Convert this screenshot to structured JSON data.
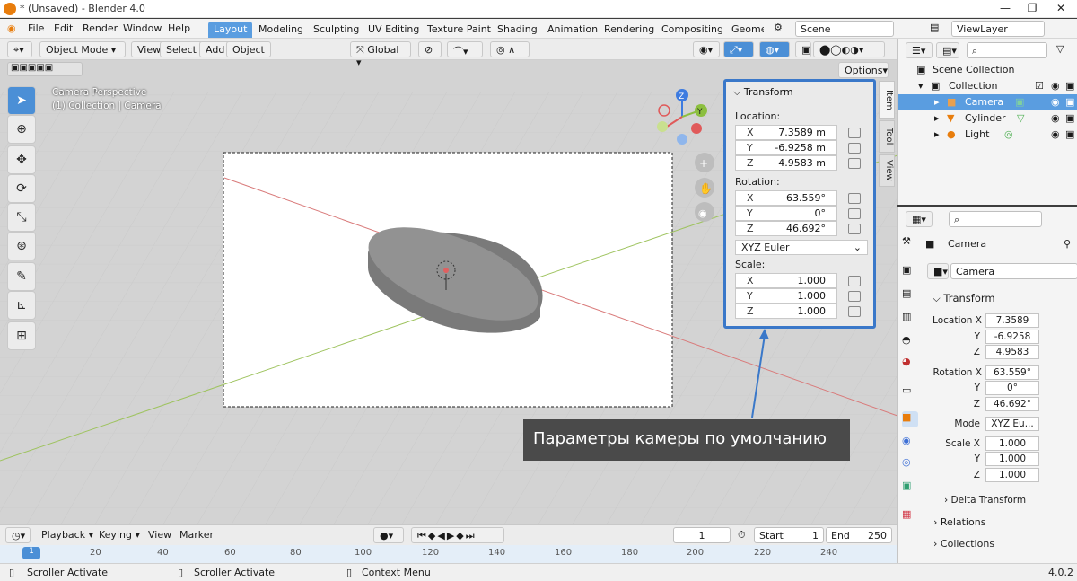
{
  "window": {
    "title": "* (Unsaved) - Blender 4.0"
  },
  "menu": [
    "File",
    "Edit",
    "Render",
    "Window",
    "Help"
  ],
  "workspaces": [
    "Layout",
    "Modeling",
    "Sculpting",
    "UV Editing",
    "Texture Paint",
    "Shading",
    "Animation",
    "Rendering",
    "Compositing",
    "Geomet"
  ],
  "scene": {
    "name": "Scene",
    "view_layer": "ViewLayer"
  },
  "viewport": {
    "mode": "Object Mode",
    "menus": [
      "View",
      "Select",
      "Add",
      "Object"
    ],
    "orientation": "Global",
    "options": "Options",
    "overlay_line1": "Camera Perspective",
    "overlay_line2": "(1) Collection | Camera"
  },
  "npanel": {
    "header": "Transform",
    "location_label": "Location:",
    "rotation_label": "Rotation:",
    "scale_label": "Scale:",
    "location": [
      {
        "k": "X",
        "v": "7.3589 m"
      },
      {
        "k": "Y",
        "v": "-6.9258 m"
      },
      {
        "k": "Z",
        "v": "4.9583 m"
      }
    ],
    "rotation": [
      {
        "k": "X",
        "v": "63.559°"
      },
      {
        "k": "Y",
        "v": "0°"
      },
      {
        "k": "Z",
        "v": "46.692°"
      }
    ],
    "rot_mode": "XYZ Euler",
    "scale": [
      {
        "k": "X",
        "v": "1.000"
      },
      {
        "k": "Y",
        "v": "1.000"
      },
      {
        "k": "Z",
        "v": "1.000"
      }
    ],
    "tabs": [
      "Item",
      "Tool",
      "View"
    ]
  },
  "callout": "Параметры камеры по умолчанию",
  "timeline": {
    "menus": [
      "Playback",
      "Keying",
      "View",
      "Marker"
    ],
    "current": "1",
    "start_label": "Start",
    "start": "1",
    "end_label": "End",
    "end": "250",
    "ticks": [
      "1",
      "20",
      "40",
      "60",
      "80",
      "100",
      "120",
      "140",
      "160",
      "180",
      "200",
      "220",
      "240"
    ]
  },
  "status": {
    "items": [
      "Scroller Activate",
      "Scroller Activate",
      "Context Menu"
    ],
    "version": "4.0.2"
  },
  "outliner": {
    "root": "Scene Collection",
    "collection": "Collection",
    "items": [
      "Camera",
      "Cylinder",
      "Light"
    ]
  },
  "properties": {
    "object": "Camera",
    "data_name": "Camera",
    "panel": "Transform",
    "location_label": "Location X",
    "location": [
      "7.3589",
      "-6.9258",
      "4.9583"
    ],
    "rotation_label": "Rotation X",
    "rotation": [
      "63.559°",
      "0°",
      "46.692°"
    ],
    "mode_label": "Mode",
    "mode": "XYZ Eu...",
    "scale_label": "Scale X",
    "scale": [
      "1.000",
      "1.000",
      "1.000"
    ],
    "axis_y": "Y",
    "axis_z": "Z",
    "delta": "Delta Transform",
    "relations": "Relations",
    "collections": "Collections"
  },
  "colors": {
    "accent": "#5a9de0",
    "callout_border": "#3a78c9",
    "x_axis": "#e05a5a",
    "y_axis": "#8cbf3f",
    "z_axis": "#3d7be0"
  }
}
